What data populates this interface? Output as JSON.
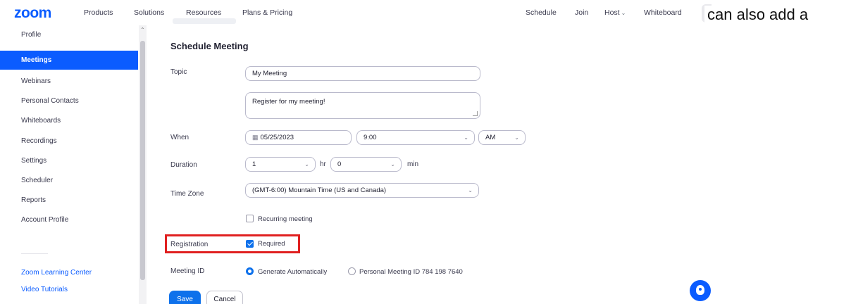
{
  "nav": {
    "logo": "zoom",
    "items": [
      "Products",
      "Solutions",
      "Resources",
      "Plans & Pricing"
    ],
    "right": [
      "Schedule",
      "Join",
      "Host",
      "Whiteboard"
    ]
  },
  "caption": "can also add a",
  "sidebar": {
    "items": [
      "Profile",
      "Meetings",
      "Webinars",
      "Personal Contacts",
      "Whiteboards",
      "Recordings",
      "Settings",
      "Scheduler",
      "Reports",
      "Account Profile"
    ],
    "active": "Meetings",
    "links": [
      "Zoom Learning Center",
      "Video Tutorials"
    ]
  },
  "form": {
    "title": "Schedule Meeting",
    "topic_label": "Topic",
    "topic_value": "My Meeting",
    "description_value": "Register for my meeting!",
    "when_label": "When",
    "date_value": "05/25/2023",
    "time_value": "9:00",
    "ampm_value": "AM",
    "duration_label": "Duration",
    "duration_hr": "1",
    "hr_unit": "hr",
    "duration_min": "0",
    "min_unit": "min",
    "timezone_label": "Time Zone",
    "timezone_value": "(GMT-6:00) Mountain Time (US and Canada)",
    "recurring_label": "Recurring meeting",
    "recurring_checked": false,
    "registration_label": "Registration",
    "required_label": "Required",
    "required_checked": true,
    "meeting_id_label": "Meeting ID",
    "meeting_id_options": [
      "Generate Automatically",
      "Personal Meeting ID 784 198 7640"
    ],
    "meeting_id_selected": "Generate Automatically",
    "save_label": "Save",
    "cancel_label": "Cancel"
  },
  "colors": {
    "brand": "#0b5cff",
    "primary_button": "#0e71eb",
    "highlight": "#e02020"
  }
}
